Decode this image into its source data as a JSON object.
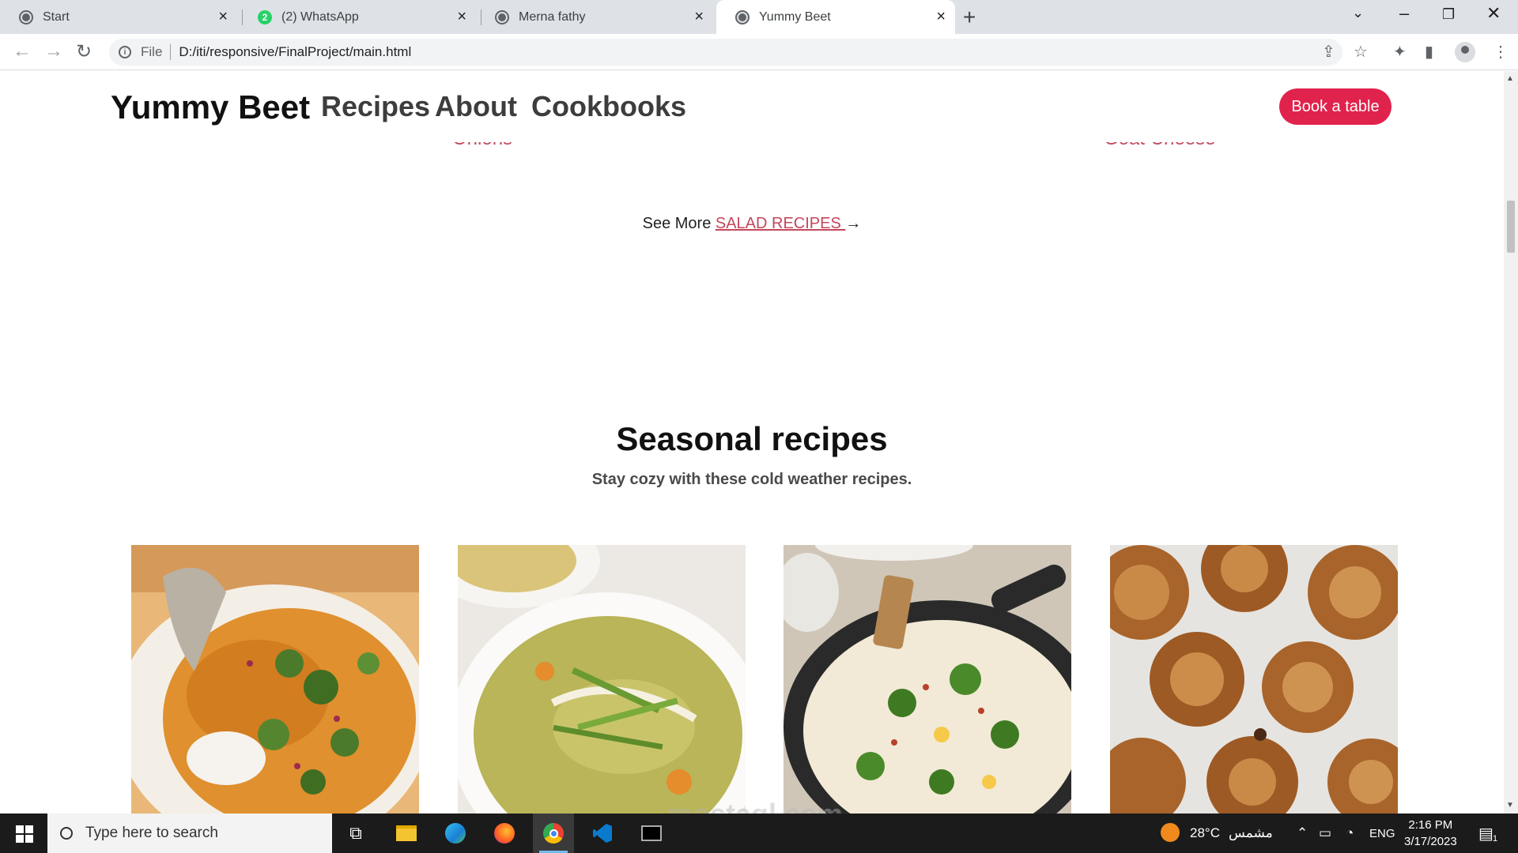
{
  "browser": {
    "tabs": [
      {
        "title": "Start",
        "icon": "globe-icon"
      },
      {
        "title": "(2) WhatsApp",
        "icon": "whatsapp-icon",
        "badge": "2"
      },
      {
        "title": "Merna fathy",
        "icon": "globe-icon"
      },
      {
        "title": "Yummy Beet",
        "icon": "globe-icon",
        "active": true
      }
    ],
    "new_tab": "+",
    "address": {
      "scheme": "File",
      "url": "D:/iti/responsive/FinalProject/main.html"
    }
  },
  "site": {
    "brand": "Yummy Beet",
    "nav": [
      "Recipes",
      "About",
      "Cookbooks"
    ],
    "cta": "Book a table",
    "cut_labels": [
      "Onions",
      "Goat Cheese"
    ],
    "see_more": {
      "prefix": "See More ",
      "link": "SALAD RECIPES ",
      "arrow": "→"
    },
    "seasonal": {
      "title": "Seasonal recipes",
      "subtitle": "Stay cozy with these cold weather recipes.",
      "cards": [
        {
          "image": "curry-dish-photo"
        },
        {
          "image": "soup-bowl-photo"
        },
        {
          "image": "skillet-eggs-photo"
        },
        {
          "image": "cinnamon-buns-photo"
        }
      ]
    },
    "watermark": "mostaql.com"
  },
  "taskbar": {
    "search_placeholder": "Type here to search",
    "weather": {
      "temp": "28°C",
      "desc": "مشمس"
    },
    "language": "ENG",
    "time": "2:16 PM",
    "date": "3/17/2023",
    "notification_count": "1"
  }
}
